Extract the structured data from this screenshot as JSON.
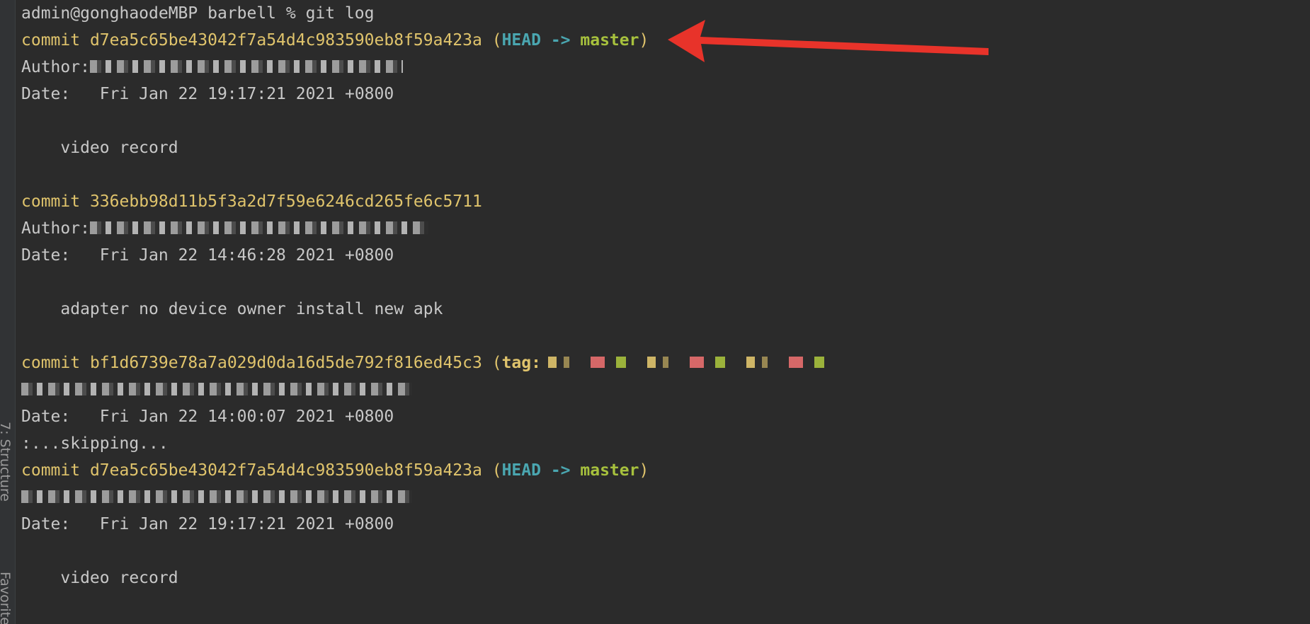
{
  "side_tabs": {
    "structure": "7: Structure",
    "favorites": "Favorites"
  },
  "terminal": {
    "prompt": "admin@gonghaodeMBP barbell % git log",
    "commits": [
      {
        "commit_word": "commit",
        "hash": "d7ea5c65be43042f7a54d4c983590eb8f59a423a",
        "head": "HEAD",
        "arrow": "->",
        "branch": "master",
        "author_label": "Author:",
        "date_label": "Date:",
        "date": "Fri Jan 22 19:17:21 2021 +0800",
        "message": "video record"
      },
      {
        "commit_word": "commit",
        "hash": "336ebb98d11b5f3a2d7f59e6246cd265fe6c5711",
        "author_label": "Author:",
        "date_label": "Date:",
        "date": "Fri Jan 22 14:46:28 2021 +0800",
        "message": "adapter no device owner install new apk"
      },
      {
        "commit_word": "commit",
        "hash": "bf1d6739e78a7a029d0da16d5de792f816ed45c3",
        "tag_label": "tag:",
        "date_label": "Date:",
        "date": "Fri Jan 22 14:00:07 2021 +0800"
      },
      {
        "commit_word": "commit",
        "hash": "d7ea5c65be43042f7a54d4c983590eb8f59a423a",
        "head": "HEAD",
        "arrow": "->",
        "branch": "master",
        "date_label": "Date:",
        "date": "Fri Jan 22 19:17:21 2021 +0800",
        "message": "video record"
      }
    ],
    "skipping": ":...skipping..."
  },
  "annotation": {
    "arrow_color": "#e8332a"
  }
}
